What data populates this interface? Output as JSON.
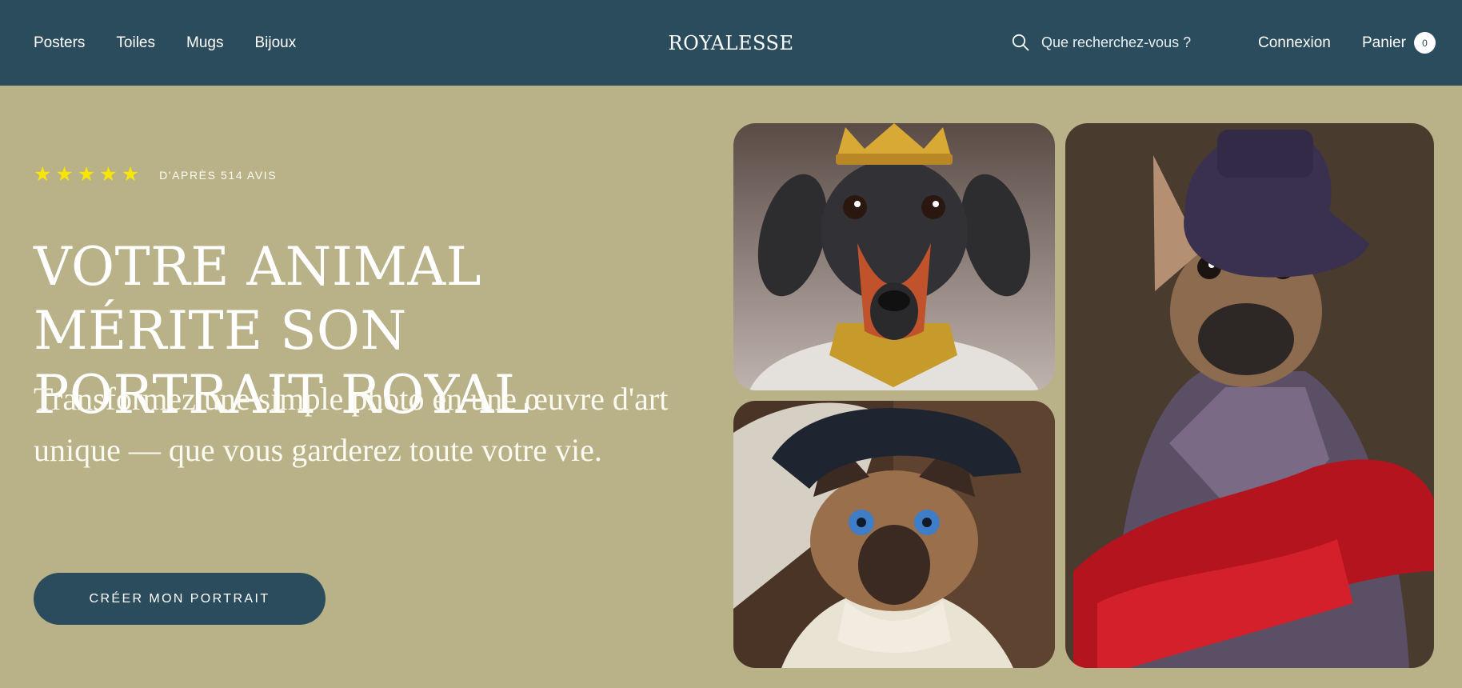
{
  "header": {
    "nav": [
      "Posters",
      "Toiles",
      "Mugs",
      "Bijoux"
    ],
    "logo": "ROYALESSE",
    "search_placeholder": "Que recherchez-vous ?",
    "account_label": "Connexion",
    "cart_label": "Panier",
    "cart_count": "0",
    "search_icon": "search-icon"
  },
  "hero": {
    "rating_stars": 5,
    "star_glyph": "★",
    "reviews_text": "D'APRÈS 514 AVIS",
    "headline": "VOTRE ANIMAL MÉRITE SON PORTRAIT ROYAL",
    "subline": "Transformez une simple photo en une œuvre d'art unique — que vous garderez toute votre vie.",
    "cta_label": "CRÉER MON PORTRAIT"
  },
  "colors": {
    "header_bg": "#2b4c5c",
    "hero_bg": "#b9b187",
    "star": "#f8e600",
    "button_bg": "#2b4c5c"
  }
}
